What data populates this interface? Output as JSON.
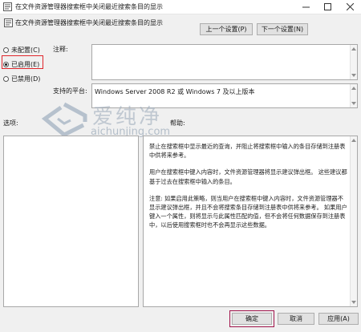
{
  "window": {
    "title": "在文件资源管理器搜索框中关闭最近搜索条目的显示"
  },
  "header": {
    "title": "在文件资源管理器搜索框中关闭最近搜索条目的显示",
    "prev_label": "上一个设置(P)",
    "next_label": "下一个设置(N)"
  },
  "options": {
    "not_configured": "未配置(C)",
    "enabled": "已启用(E)",
    "disabled": "已禁用(D)",
    "selected": "enabled"
  },
  "labels": {
    "comment": "注释:",
    "supported_on": "支持的平台:",
    "options": "选项:",
    "help": "帮助:"
  },
  "comment": {
    "value": ""
  },
  "supported": {
    "value": "Windows Server 2008 R2 或 Windows 7 及以上版本"
  },
  "help_text": {
    "p1": "禁止在搜索框中显示最近的查询，并阻止将搜索框中输入的条目存储到注册表中供将来参考。",
    "p2": "用户在搜索框中键入内容时，文件资源管理器将显示建议弹出框。 这些建议都基于过去在搜索框中输入的条目。",
    "p3": "注意: 如果启用此策略，则当用户在搜索框中键入内容时，文件资源管理器不显示建议弹出框，并且不会将搜索条目存储到注册表中供将来参考。 如果用户键入一个属性，则将显示与此属性匹配的值，但不会将任何数据保存到注册表中，以后使用搜索框时也不会再显示这些数据。"
  },
  "watermark": {
    "brand_cn": "爱纯净",
    "url": "aichunjing.com"
  },
  "buttons": {
    "ok": "确定",
    "cancel": "取消",
    "apply": "应用(A)"
  },
  "colors": {
    "highlight_red": "#e0262b",
    "ok_highlight": "#a0134a"
  }
}
